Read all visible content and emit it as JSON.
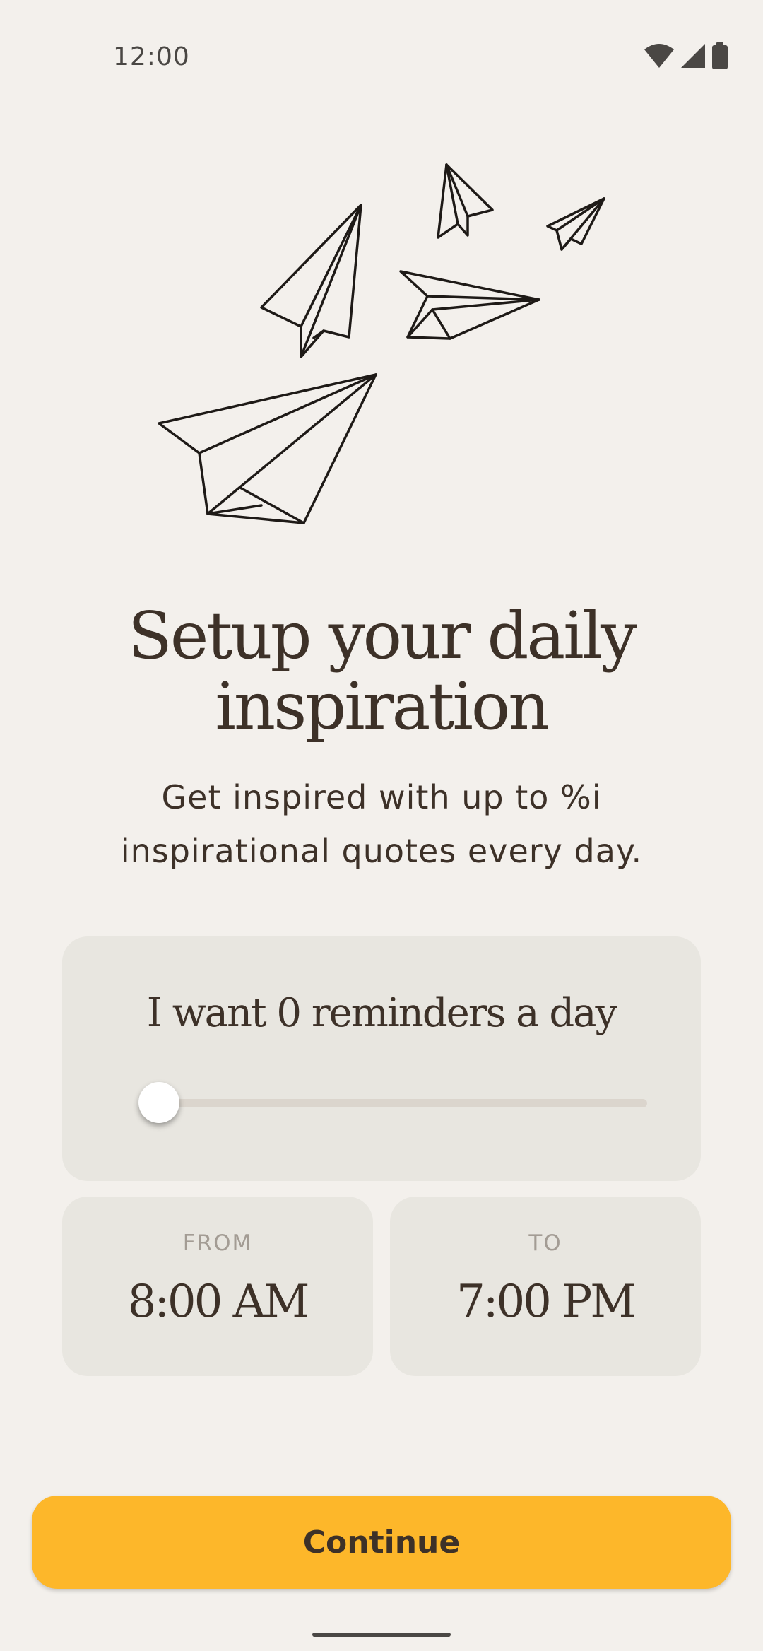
{
  "status_bar": {
    "time": "12:00",
    "icons": [
      "wifi-icon",
      "cellular-signal-icon",
      "battery-icon"
    ]
  },
  "illustration": {
    "icon": "paper-planes-illustration"
  },
  "header": {
    "title_line1": "Setup your daily",
    "title_line2": "inspiration",
    "subtitle_line1": "Get inspired with up to %i",
    "subtitle_line2": "inspirational quotes every day."
  },
  "reminder": {
    "label": "I want 0 reminders a day",
    "slider_value": 0
  },
  "schedule": {
    "from_label": "FROM",
    "from_value": "8:00 AM",
    "to_label": "TO",
    "to_value": "7:00 PM"
  },
  "actions": {
    "continue_label": "Continue"
  },
  "colors": {
    "background": "#f3f0ec",
    "card": "#e8e6e0",
    "text": "#3d3128",
    "muted_label": "#a39c94",
    "accent": "#fdb72a"
  }
}
